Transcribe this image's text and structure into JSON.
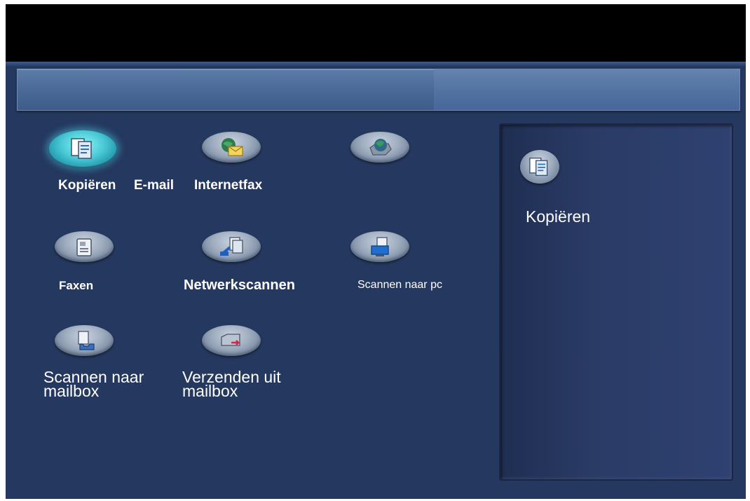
{
  "services": [
    {
      "id": "kopieren",
      "label": "Kopiëren",
      "icon": "copy-icon",
      "active": true
    },
    {
      "id": "email",
      "label": "E-mail",
      "icon": "email-icon",
      "active": false
    },
    {
      "id": "internetfax",
      "label": "Internetfax",
      "icon": "internet-fax-icon",
      "active": false
    },
    {
      "id": "faxen",
      "label": "Faxen",
      "icon": "fax-icon",
      "active": false
    },
    {
      "id": "netwerkscannen",
      "label": "Netwerkscannen",
      "icon": "network-scan-icon",
      "active": false
    },
    {
      "id": "scannen-naar-pc",
      "label": "Scannen naar pc",
      "icon": "scan-to-pc-icon",
      "active": false
    },
    {
      "id": "scannen-naar-mailbox",
      "label_line1": "Scannen naar",
      "label_line2": "mailbox",
      "icon": "scan-to-mailbox-icon",
      "active": false
    },
    {
      "id": "verzenden-uit-mailbox",
      "label_line1": "Verzenden uit",
      "label_line2": "mailbox",
      "icon": "send-from-mailbox-icon",
      "active": false
    }
  ],
  "selected": {
    "label": "Kopiëren",
    "icon": "copy-icon"
  },
  "colors": {
    "background": "#25385f",
    "topbar": "#000000",
    "active_glow": "#49c9d5",
    "text": "#ffffff"
  }
}
